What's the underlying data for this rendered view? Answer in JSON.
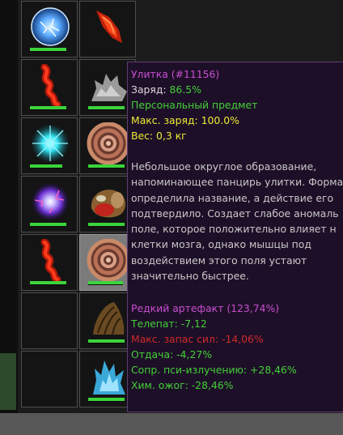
{
  "inventory": {
    "slots": [
      {
        "icon": "blue-plasma-sphere-icon",
        "charge": 0.9,
        "selected": false
      },
      {
        "icon": "red-crystal-shard-icon",
        "charge": null,
        "selected": false
      },
      {
        "icon": "red-tangled-artifact-icon",
        "charge": 0.9,
        "selected": false
      },
      {
        "icon": "silver-crystal-cluster-icon",
        "charge": 0.9,
        "selected": false
      },
      {
        "icon": "cyan-burst-artifact-icon",
        "charge": 0.8,
        "selected": false
      },
      {
        "icon": "snail-shell-artifact-icon",
        "charge": 0.9,
        "selected": false
      },
      {
        "icon": "violet-electric-orb-icon",
        "charge": 0.9,
        "selected": false
      },
      {
        "icon": "organic-blob-artifact-icon",
        "charge": 0.9,
        "selected": false
      },
      {
        "icon": "red-tangled-artifact-icon",
        "charge": 0.9,
        "selected": false
      },
      {
        "icon": "snail-shell-artifact-icon",
        "charge": 0.85,
        "selected": true
      },
      {
        "icon": null,
        "charge": null,
        "selected": false
      },
      {
        "icon": "brown-pod-artifact-icon",
        "charge": 0.9,
        "selected": false
      },
      {
        "icon": null,
        "charge": null,
        "selected": false
      },
      {
        "icon": "ice-crystal-artifact-icon",
        "charge": 0.9,
        "selected": false
      }
    ],
    "colors": {
      "bar": "#3bd43b",
      "selected_bg": "#7b7b7b",
      "slot_bg": "#141414"
    }
  },
  "tooltip": {
    "title": "Улитка (#11156)",
    "charge_label": "Заряд: ",
    "charge_value": "86.5%",
    "personal": "Персональный предмет",
    "max_charge": "Макс. заряд: 100.0%",
    "weight": "Вес: 0,3 кг",
    "description": [
      "Небольшое округлое образование,",
      "напоминающее панцирь улитки. Форма",
      "определила название, а действие его",
      "подтвердило. Создает слабое аномаль",
      "поле, которое положительно влияет н",
      "клетки мозга, однако мышцы под",
      "воздействием этого поля устают",
      "значительно быстрее."
    ],
    "rarity": "Редкий артефакт (123,74%)",
    "stats": [
      {
        "text": "Телепат: -7,12",
        "color": "green"
      },
      {
        "text": "Макс. запас сил: -14,06%",
        "color": "red"
      },
      {
        "text": "Отдача: -4,27%",
        "color": "green"
      },
      {
        "text": "Сопр. пси-излучению: +28,46%",
        "color": "green"
      },
      {
        "text": "Хим. ожог: -28,46%",
        "color": "green"
      }
    ]
  }
}
